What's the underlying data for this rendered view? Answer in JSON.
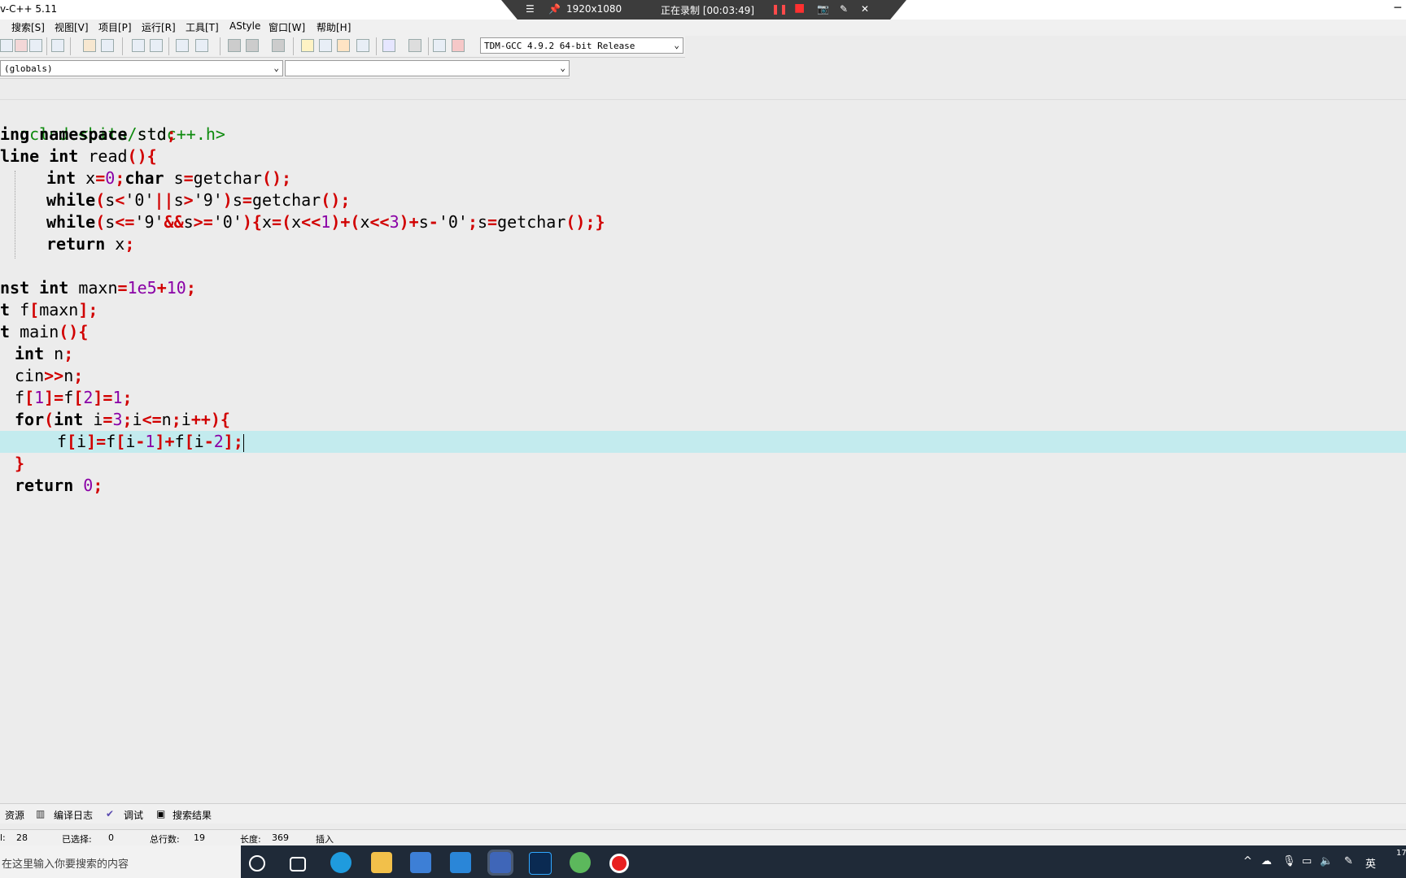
{
  "window": {
    "title": "v-C++ 5.11",
    "minimize": "─"
  },
  "recorder": {
    "menu": "☰",
    "pin": "📌",
    "resolution": "1920x1080",
    "status": "正在录制 [00:03:49]",
    "pause": "❚❚",
    "stop": "■",
    "camera": "📷",
    "pen": "✎",
    "close": "✕"
  },
  "menu": [
    "搜索[S]",
    "视图[V]",
    "项目[P]",
    "运行[R]",
    "工具[T]",
    "AStyle",
    "窗口[W]",
    "帮助[H]"
  ],
  "toolbar": {
    "compiler": "TDM-GCC 4.9.2 64-bit Release",
    "chevron": "⌄"
  },
  "scope": {
    "class": "(globals)",
    "member": ""
  },
  "code": {
    "l1": {
      "pp": "nclude<bits/stdc++.h>"
    },
    "l2": {
      "k": "ing namespace",
      "id": " std",
      "o": ";"
    },
    "l3": {
      "k": "line int",
      "id": " read",
      "o": "(){"
    },
    "l4": {
      "k1": "int",
      "id1": " x",
      "o1": "=",
      "n1": "0",
      "o2": ";",
      "k2": "char",
      "id2": " s",
      "o3": "=",
      "id3": "getchar",
      "o4": "();"
    },
    "l5": {
      "k": "while",
      "o1": "(",
      "id1": "s",
      "o2": "<",
      "s1": "'0'",
      "o3": "||",
      "id2": "s",
      "o4": ">",
      "s2": "'9'",
      "o5": ")",
      "id3": "s",
      "o6": "=",
      "id4": "getchar",
      "o7": "();"
    },
    "l6": {
      "k": "while",
      "o1": "(",
      "id1": "s",
      "o2": "<=",
      "s1": "'9'",
      "o3": "&&",
      "id2": "s",
      "o4": ">=",
      "s2": "'0'",
      "o5": "){",
      "id3": "x",
      "o6": "=(",
      "id4": "x",
      "o7": "<<",
      "n1": "1",
      "o8": ")+(",
      "id5": "x",
      "o9": "<<",
      "n2": "3",
      "o10": ")+",
      "id6": "s",
      "o11": "-",
      "s3": "'0'",
      "o12": ";",
      "id7": "s",
      "o13": "=",
      "id8": "getchar",
      "o14": "();}"
    },
    "l7": {
      "k": "return",
      "id": " x",
      "o": ";"
    },
    "l9": {
      "k": "nst int",
      "id": " maxn",
      "o1": "=",
      "n": "1e5",
      "o2": "+",
      "n2": "10",
      "o3": ";"
    },
    "l10": {
      "k": "t",
      "id": " f",
      "o1": "[",
      "id2": "maxn",
      "o2": "];"
    },
    "l11": {
      "k": "t",
      "id": " main",
      "o": "(){"
    },
    "l12": {
      "k": "int",
      "id": " n",
      "o": ";"
    },
    "l13": {
      "id": "cin",
      "o1": ">>",
      "id2": "n",
      "o2": ";"
    },
    "l14": {
      "id": "f",
      "o1": "[",
      "n1": "1",
      "o2": "]=",
      "id2": "f",
      "o3": "[",
      "n2": "2",
      "o4": "]=",
      "n3": "1",
      "o5": ";"
    },
    "l15": {
      "k1": "for",
      "o1": "(",
      "k2": "int",
      "id1": " i",
      "o2": "=",
      "n1": "3",
      "o3": ";",
      "id2": "i",
      "o4": "<=",
      "id3": "n",
      "o5": ";",
      "id4": "i",
      "o6": "++){"
    },
    "l16": {
      "id1": "f",
      "o1": "[",
      "id2": "i",
      "o2": "]=",
      "id3": "f",
      "o3": "[",
      "id4": "i",
      "o4": "-",
      "n1": "1",
      "o5": "]+",
      "id5": "f",
      "o6": "[",
      "id6": "i",
      "o7": "-",
      "n2": "2",
      "o8": "];"
    },
    "l17": {
      "o": "}"
    },
    "l18": {
      "k": "return",
      "n": " 0",
      "o": ";"
    }
  },
  "bottom_tabs": [
    "资源",
    "编译日志",
    "调试",
    "搜索结果"
  ],
  "status": {
    "line_label": "l:",
    "line": "28",
    "sel_label": "已选择:",
    "sel": "0",
    "total_label": "总行数:",
    "total": "19",
    "len_label": "长度:",
    "len": "369",
    "mode": "插入"
  },
  "taskbar": {
    "search_placeholder": "在这里输入你要搜索的内容",
    "ime": "英",
    "clock": "17"
  }
}
